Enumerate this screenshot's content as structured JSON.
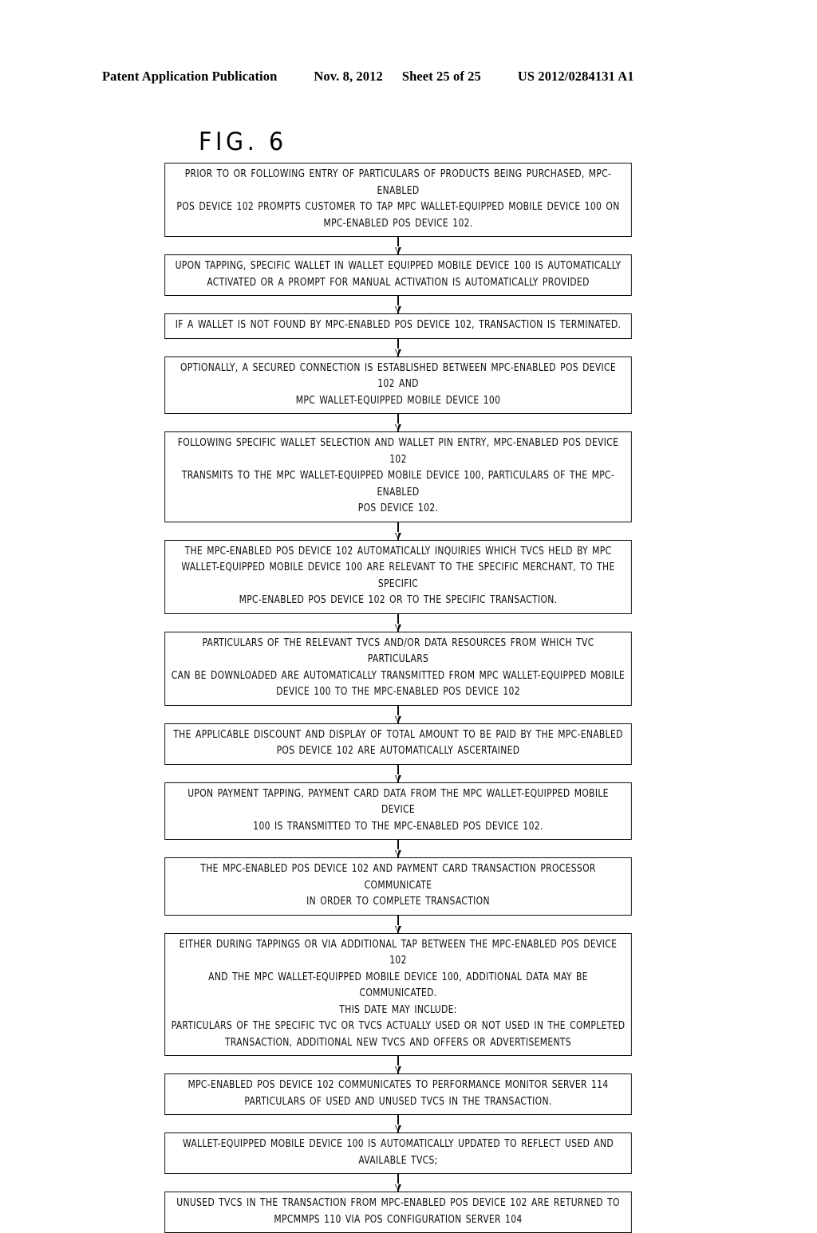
{
  "header": {
    "publication": "Patent Application Publication",
    "date": "Nov. 8, 2012",
    "sheet": "Sheet 25 of 25",
    "number": "US 2012/0284131 A1"
  },
  "figure": {
    "title": "FIG.  6",
    "type": "flowchart",
    "steps": [
      {
        "id": "step-1",
        "text": "PRIOR TO OR FOLLOWING ENTRY OF PARTICULARS OF PRODUCTS BEING PURCHASED, MPC-ENABLED\nPOS DEVICE 102 PROMPTS CUSTOMER TO TAP MPC WALLET-EQUIPPED MOBILE DEVICE 100 ON\nMPC-ENABLED POS DEVICE 102."
      },
      {
        "id": "step-2",
        "text": "UPON TAPPING, SPECIFIC WALLET IN WALLET EQUIPPED MOBILE DEVICE 100 IS AUTOMATICALLY\nACTIVATED OR A PROMPT FOR MANUAL ACTIVATION IS AUTOMATICALLY PROVIDED"
      },
      {
        "id": "step-3",
        "text": "IF A WALLET IS NOT FOUND BY MPC-ENABLED POS DEVICE 102, TRANSACTION IS TERMINATED."
      },
      {
        "id": "step-4",
        "text": "OPTIONALLY, A SECURED CONNECTION IS ESTABLISHED BETWEEN MPC-ENABLED POS DEVICE 102 AND\nMPC WALLET-EQUIPPED MOBILE DEVICE 100"
      },
      {
        "id": "step-5",
        "text": "FOLLOWING SPECIFIC WALLET SELECTION AND WALLET PIN ENTRY, MPC-ENABLED POS DEVICE 102\nTRANSMITS TO THE MPC WALLET-EQUIPPED MOBILE DEVICE 100, PARTICULARS OF THE MPC-ENABLED\nPOS DEVICE 102."
      },
      {
        "id": "step-6",
        "text": "THE MPC-ENABLED POS DEVICE 102 AUTOMATICALLY INQUIRIES WHICH TVCS HELD BY MPC\nWALLET-EQUIPPED MOBILE DEVICE 100 ARE RELEVANT TO THE SPECIFIC MERCHANT, TO THE SPECIFIC\nMPC-ENABLED POS DEVICE 102 OR TO THE SPECIFIC TRANSACTION."
      },
      {
        "id": "step-7",
        "text": "PARTICULARS OF THE RELEVANT TVCS AND/OR DATA RESOURCES FROM WHICH TVC PARTICULARS\nCAN BE DOWNLOADED ARE AUTOMATICALLY TRANSMITTED FROM MPC WALLET-EQUIPPED MOBILE\nDEVICE 100 TO THE MPC-ENABLED POS DEVICE 102"
      },
      {
        "id": "step-8",
        "text": "THE APPLICABLE DISCOUNT  AND DISPLAY OF TOTAL AMOUNT TO BE PAID BY THE MPC-ENABLED\nPOS DEVICE 102 ARE AUTOMATICALLY ASCERTAINED"
      },
      {
        "id": "step-9",
        "text": "UPON  PAYMENT TAPPING, PAYMENT CARD DATA FROM THE  MPC WALLET-EQUIPPED MOBILE DEVICE\n100 IS TRANSMITTED TO THE MPC-ENABLED POS DEVICE 102."
      },
      {
        "id": "step-10",
        "text": "THE MPC-ENABLED POS DEVICE 102 AND PAYMENT CARD TRANSACTION PROCESSOR COMMUNICATE\nIN ORDER TO COMPLETE TRANSACTION"
      },
      {
        "id": "step-11",
        "text": "EITHER DURING TAPPINGS OR VIA ADDITIONAL TAP BETWEEN THE MPC-ENABLED POS DEVICE 102\nAND THE MPC WALLET-EQUIPPED MOBILE DEVICE 100, ADDITIONAL DATA MAY BE COMMUNICATED.\nTHIS DATE MAY INCLUDE:\nPARTICULARS OF THE SPECIFIC TVC OR TVCS ACTUALLY USED OR NOT USED IN THE COMPLETED\nTRANSACTION, ADDITIONAL NEW TVCS AND OFFERS OR ADVERTISEMENTS"
      },
      {
        "id": "step-12",
        "text": "MPC-ENABLED POS DEVICE 102 COMMUNICATES TO PERFORMANCE MONITOR SERVER 114\nPARTICULARS OF USED AND UNUSED TVCS IN THE TRANSACTION."
      },
      {
        "id": "step-13",
        "text": "WALLET-EQUIPPED MOBILE DEVICE 100 IS AUTOMATICALLY UPDATED TO REFLECT USED AND\nAVAILABLE TVCS;"
      },
      {
        "id": "step-14",
        "text": "UNUSED TVCS IN THE TRANSACTION FROM MPC-ENABLED POS DEVICE 102 ARE RETURNED TO\nMPCMMPS 110 VIA POS CONFIGURATION SERVER 104"
      }
    ]
  },
  "colors": {
    "ink": "#0d0d0d",
    "background": "#ffffff"
  }
}
